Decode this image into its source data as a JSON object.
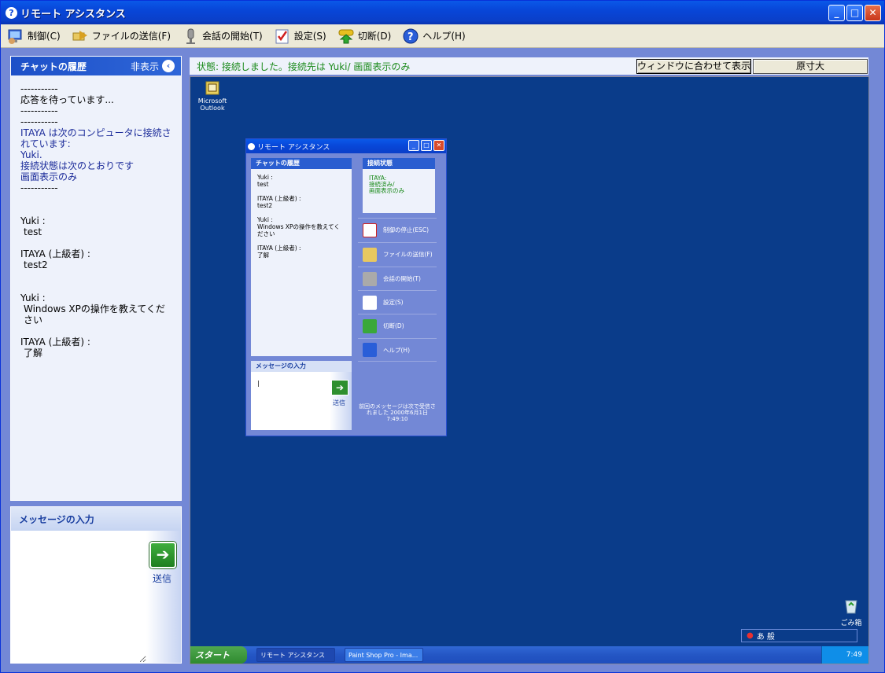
{
  "window": {
    "title": "リモート アシスタンス"
  },
  "menu": [
    {
      "label": "制御(C)",
      "icon": "monitor-user-icon"
    },
    {
      "label": "ファイルの送信(F)",
      "icon": "file-send-icon"
    },
    {
      "label": "会話の開始(T)",
      "icon": "microphone-icon"
    },
    {
      "label": "設定(S)",
      "icon": "settings-check-icon"
    },
    {
      "label": "切断(D)",
      "icon": "disconnect-icon"
    },
    {
      "label": "ヘルプ(H)",
      "icon": "help-icon"
    }
  ],
  "chat": {
    "title": "チャットの履歴",
    "hide_label": "非表示",
    "lines": [
      {
        "text": "-----------",
        "kind": "sep"
      },
      {
        "text": "応答を待っています...",
        "kind": "plain"
      },
      {
        "text": "-----------",
        "kind": "sep"
      },
      {
        "text": "-----------",
        "kind": "sep"
      },
      {
        "text": "ITAYA は次のコンピュータに接続されています:",
        "kind": "sys"
      },
      {
        "text": "Yuki.",
        "kind": "sys"
      },
      {
        "text": "接続状態は次のとおりです",
        "kind": "sys"
      },
      {
        "text": "画面表示のみ",
        "kind": "sys"
      },
      {
        "text": "-----------",
        "kind": "sep"
      },
      {
        "text": "",
        "kind": "gap"
      },
      {
        "text": "",
        "kind": "gap"
      },
      {
        "text": "Yuki :",
        "kind": "plain"
      },
      {
        "text": " test",
        "kind": "plain"
      },
      {
        "text": "",
        "kind": "gap"
      },
      {
        "text": "ITAYA (上級者) :",
        "kind": "plain"
      },
      {
        "text": " test2",
        "kind": "plain"
      },
      {
        "text": "",
        "kind": "gap"
      },
      {
        "text": "",
        "kind": "gap"
      },
      {
        "text": "Yuki :",
        "kind": "plain"
      },
      {
        "text": " Windows XPの操作を教えてください",
        "kind": "plain"
      },
      {
        "text": "",
        "kind": "gap"
      },
      {
        "text": "ITAYA (上級者) :",
        "kind": "plain"
      },
      {
        "text": " 了解",
        "kind": "plain"
      }
    ]
  },
  "message": {
    "title": "メッセージの入力",
    "value": "",
    "send_label": "送信"
  },
  "status": {
    "text": "状態: 接続しました。接続先は Yuki/ 画面表示のみ",
    "fit_label": "ウィンドウに合わせて表示",
    "original_label": "原寸大"
  },
  "remote": {
    "desktop_icon_label": "Microsoft Outlook",
    "window_title": "リモート アシスタンス",
    "chat_title": "チャットの履歴",
    "chat_lines": [
      "Yuki :",
      "test",
      "",
      "ITAYA (上級者) :",
      "test2",
      "",
      "Yuki :",
      "Windows XPの操作を教えてください",
      "",
      "ITAYA (上級者) :",
      "了解"
    ],
    "msg_title": "メッセージの入力",
    "msg_value": "|",
    "send_label": "送信",
    "status_title": "接続状態",
    "status_lines": [
      "ITAYA:",
      "接続済み/",
      "画面表示のみ"
    ],
    "actions": [
      "制御の停止(ESC)",
      "ファイルの送信(F)",
      "会話の開始(T)",
      "設定(S)",
      "切断(D)",
      "ヘルプ(H)"
    ],
    "last_message": "前回のメッセージは次で受信されました 2000年6月1日 7:49:10",
    "recycle_label": "ごみ箱",
    "lang_text": "あ 般",
    "start_label": "スタート",
    "tasks": [
      "リモート アシスタンス",
      "Paint Shop Pro - Ima..."
    ],
    "clock": "7:49"
  }
}
